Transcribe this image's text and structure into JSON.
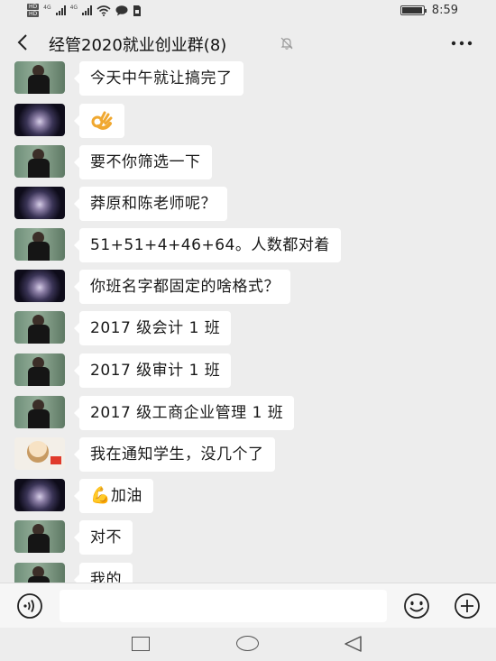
{
  "status_bar": {
    "hd_label": "HD",
    "net_label_1": "4G",
    "net_label_2": "4G",
    "battery_level": 0.95,
    "time": "8:59"
  },
  "header": {
    "title": "经管2020就业创业群(8)",
    "icons": {
      "back": "back-arrow-icon",
      "mute": "mute-bell-icon",
      "more": "more-icon"
    }
  },
  "messages": [
    {
      "avatar": "person",
      "text": "今天中午就让搞完了"
    },
    {
      "avatar": "galaxy",
      "text": "",
      "emoji": "ok-hand-icon"
    },
    {
      "avatar": "person",
      "text": "要不你筛选一下"
    },
    {
      "avatar": "galaxy",
      "text": "莽原和陈老师呢？"
    },
    {
      "avatar": "person",
      "text": "51+51+4+46+64。人数都对着"
    },
    {
      "avatar": "galaxy",
      "text": "你班名字都固定的啥格式？"
    },
    {
      "avatar": "person",
      "text": "2017 级会计 1 班"
    },
    {
      "avatar": "person",
      "text": "2017 级审计 1 班"
    },
    {
      "avatar": "person",
      "text": "2017 级工商企业管理 1 班"
    },
    {
      "avatar": "cartoon",
      "text": "我在通知学生，没几个了"
    },
    {
      "avatar": "galaxy",
      "text": "加油",
      "emoji": "💪"
    },
    {
      "avatar": "person",
      "text": "对不"
    },
    {
      "avatar": "person",
      "text": "我的"
    }
  ],
  "input_bar": {
    "value": "",
    "icons": {
      "voice": "voice-icon",
      "emoji": "emoji-icon",
      "plus": "plus-icon"
    }
  },
  "nav_bar": {
    "icons": [
      "recent-apps-icon",
      "home-icon",
      "back-triangle-icon"
    ]
  }
}
